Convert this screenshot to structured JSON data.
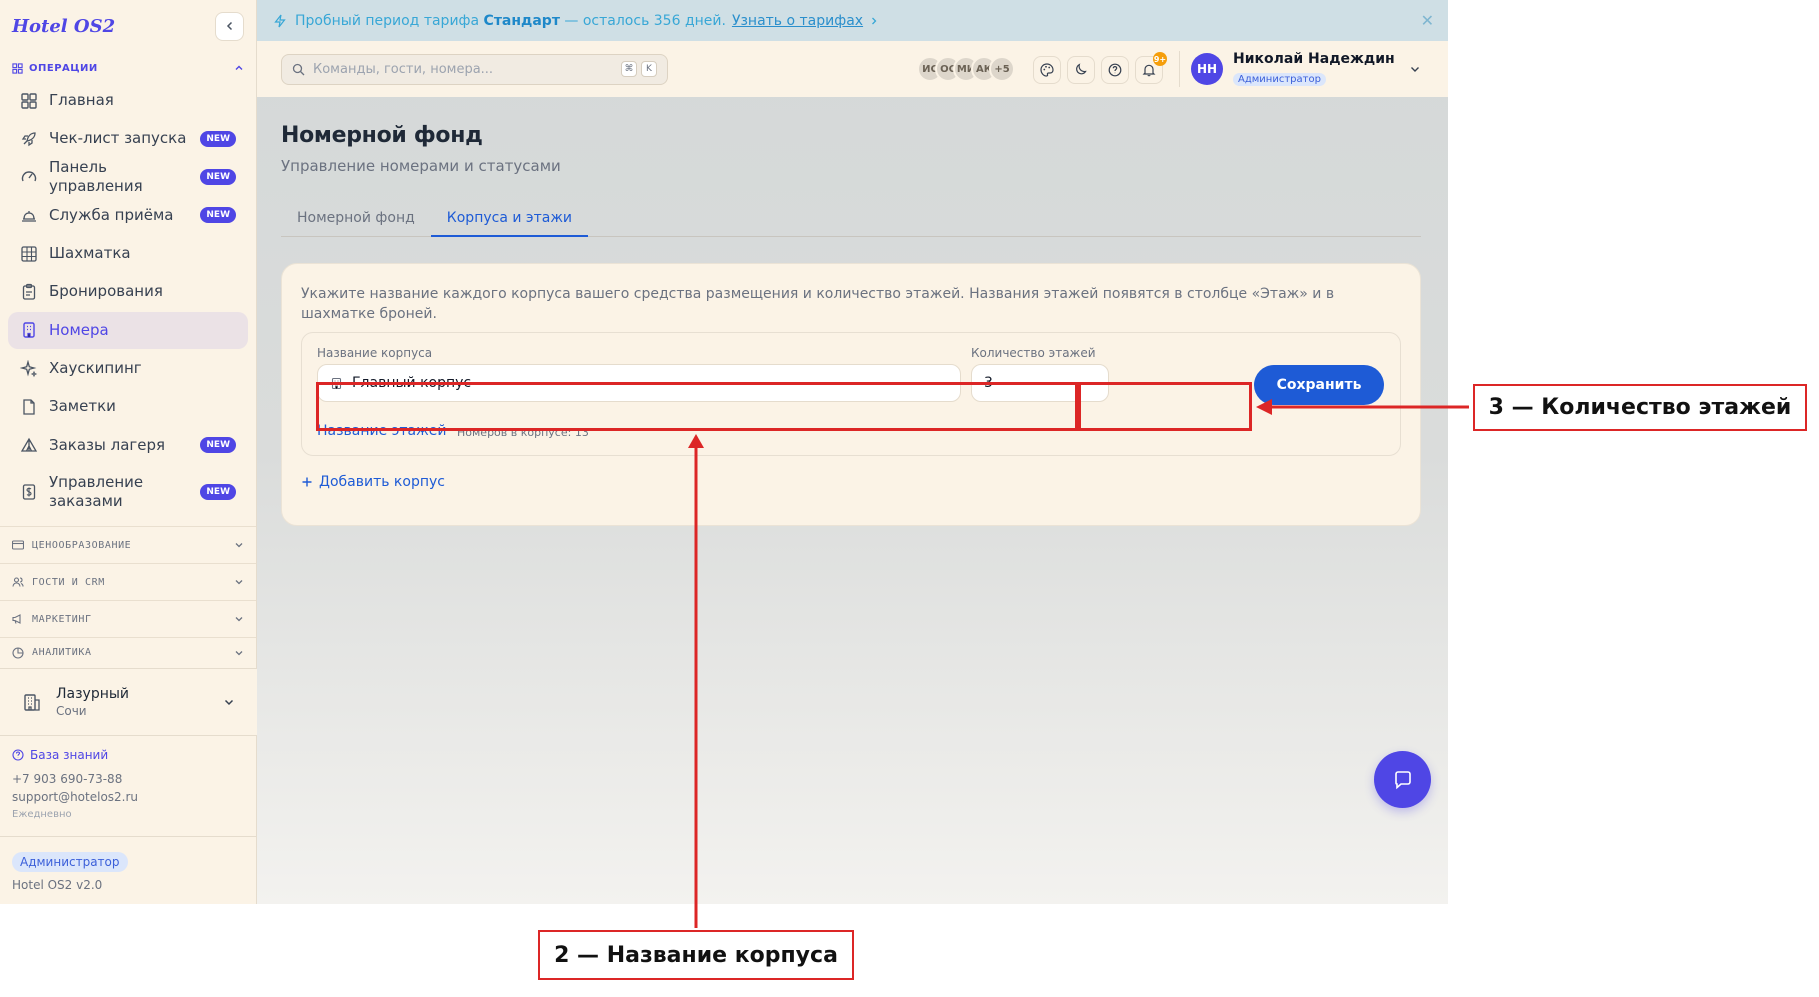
{
  "sidebar": {
    "logo": "Hotel OS2",
    "section_operations": "ОПЕРАЦИИ",
    "items": [
      {
        "label": "Главная",
        "badge": ""
      },
      {
        "label": "Чек-лист запуска",
        "badge": "NEW"
      },
      {
        "label": "Панель управления",
        "badge": "NEW"
      },
      {
        "label": "Служба приёма",
        "badge": "NEW"
      },
      {
        "label": "Шахматка",
        "badge": ""
      },
      {
        "label": "Бронирования",
        "badge": ""
      },
      {
        "label": "Номера",
        "badge": ""
      },
      {
        "label": "Хаускипинг",
        "badge": ""
      },
      {
        "label": "Заметки",
        "badge": ""
      },
      {
        "label": "Заказы лагеря",
        "badge": "NEW"
      },
      {
        "label": "Управление заказами",
        "badge": "NEW"
      }
    ],
    "groups": [
      "ЦЕНООБРАЗОВАНИЕ",
      "ГОСТИ И CRM",
      "МАРКЕТИНГ",
      "АНАЛИТИКА"
    ],
    "hotel": {
      "name": "Лазурный",
      "city": "Сочи"
    },
    "support": {
      "kb_label": "База знаний",
      "phone": "+7 903 690-73-88",
      "email": "support@hotelos2.ru",
      "hours": "Ежедневно"
    },
    "role": "Администратор",
    "version": "Hotel OS2 v2.0"
  },
  "trial": {
    "prefix": "Пробный период тарифа",
    "plan": "Стандарт",
    "suffix": "— осталось 356 дней.",
    "link": "Узнать о тарифах"
  },
  "topbar": {
    "search_placeholder": "Команды, гости, номера...",
    "kbd_1": "⌘",
    "kbd_2": "K",
    "avatars": [
      "ИС",
      "ОС",
      "МИ",
      "АК",
      "+5"
    ],
    "notif_count": "9+",
    "user_initials": "НН",
    "user_name": "Николай Надеждин",
    "user_role": "Администратор"
  },
  "page": {
    "title": "Номерной фонд",
    "subtitle": "Управление номерами и статусами",
    "tabs": [
      "Номерной фонд",
      "Корпуса и этажи"
    ],
    "active_tab": "Корпуса и этажи"
  },
  "card": {
    "description": "Укажите название каждого корпуса вашего средства размещения и количество этажей. Названия этажей появятся в столбце «Этаж» и в шахматке броней.",
    "corp_label": "Название корпуса",
    "corp_value": "Главный корпус",
    "floors_label": "Количество этажей",
    "floors_value": "3",
    "save": "Сохранить",
    "floors_link": "Название этажей",
    "rooms_count": "Номеров в корпусе: 13",
    "add_corp": "Добавить корпус"
  },
  "annotations": {
    "a2": "2 — Название корпуса",
    "a3": "3 — Количество этажей"
  },
  "colors": {
    "accent": "#4f46e5",
    "primary_blue": "#1e5bd6",
    "annotation_red": "#dc2626",
    "sidebar_bg": "#fbf3e6"
  }
}
